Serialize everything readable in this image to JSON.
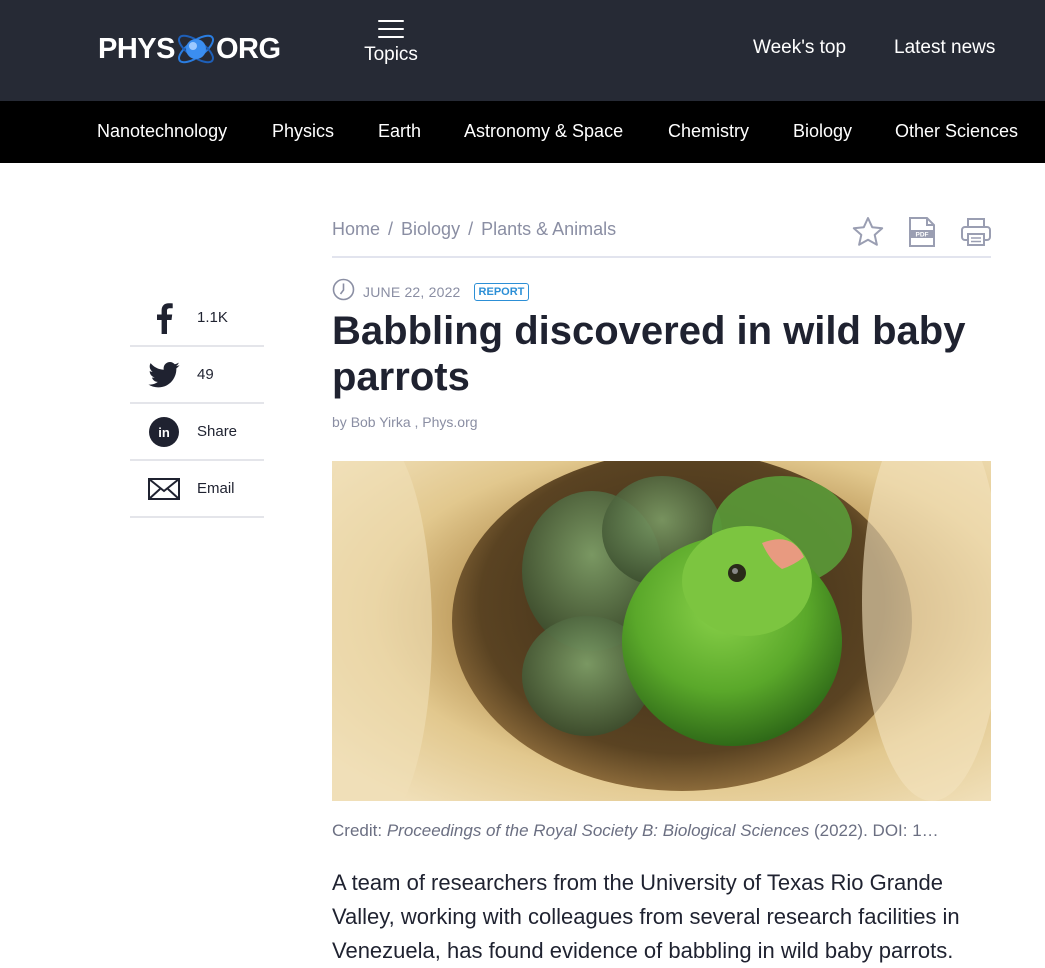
{
  "header": {
    "logo_left": "PHYS",
    "logo_right": "ORG",
    "topics_label": "Topics",
    "links": [
      "Week's top",
      "Latest news"
    ]
  },
  "nav": {
    "items": [
      "Nanotechnology",
      "Physics",
      "Earth",
      "Astronomy & Space",
      "Chemistry",
      "Biology",
      "Other Sciences"
    ]
  },
  "breadcrumb": {
    "items": [
      "Home",
      "Biology",
      "Plants & Animals"
    ],
    "separator": "/"
  },
  "share": {
    "facebook": "1.1K",
    "twitter": "49",
    "linkedin": "Share",
    "email": "Email"
  },
  "article": {
    "date": "JUNE 22, 2022",
    "badge": "REPORT",
    "title": "Babbling discovered in wild baby parrots",
    "byline_prefix": "by",
    "author": "Bob Yirka",
    "source": "Phys.org",
    "caption_prefix": "Credit:",
    "caption_journal": "Proceedings of the Royal Society B: Biological Sciences",
    "caption_suffix": "(2022). DOI: 1…",
    "body": "A team of researchers from the University of Texas Rio Grande Valley, working with colleagues from several research facilities in Venezuela, has found evidence of babbling in wild baby parrots."
  },
  "colors": {
    "header_bg": "#262a35",
    "nav_bg": "#000000",
    "accent_blue": "#2c8fd6",
    "muted_text": "#8a8ea3",
    "title_text": "#1f2230"
  },
  "icons": [
    "facebook-icon",
    "twitter-icon",
    "linkedin-icon",
    "email-icon",
    "star-icon",
    "pdf-icon",
    "print-icon",
    "clock-icon",
    "menu-icon"
  ]
}
